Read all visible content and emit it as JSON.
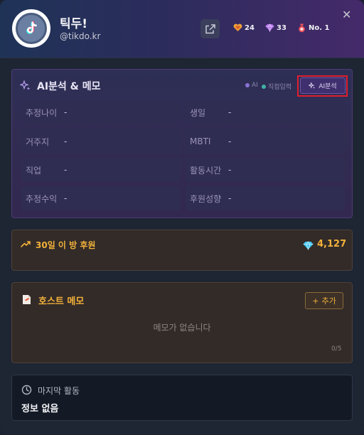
{
  "header": {
    "name": "틱두!",
    "handle": "@tikdo.kr",
    "stats": [
      {
        "icon": "heart-badge-icon",
        "value": "24",
        "color": "#f1a43a"
      },
      {
        "icon": "diamond-icon",
        "value": "33",
        "color": "#b070e8"
      },
      {
        "icon": "medal-icon",
        "value": "No. 1",
        "color": "#e8505a"
      }
    ]
  },
  "ai_panel": {
    "title": "AI분석 & 메모",
    "legend": [
      {
        "label": "AI",
        "color": "#8a73d6"
      },
      {
        "label": "직접입력",
        "color": "#3fb3a4"
      }
    ],
    "button_label": "AI분석",
    "fields": [
      {
        "label": "추정나이",
        "value": "-"
      },
      {
        "label": "생일",
        "value": "-"
      },
      {
        "label": "거주지",
        "value": "-"
      },
      {
        "label": "MBTI",
        "value": "-"
      },
      {
        "label": "직업",
        "value": "-"
      },
      {
        "label": "활동시간",
        "value": "-"
      },
      {
        "label": "추정수익",
        "value": "-"
      },
      {
        "label": "후원성향",
        "value": "-"
      }
    ]
  },
  "donation": {
    "title": "30일 이 방 후원",
    "value": "4,127"
  },
  "memo": {
    "title": "호스트 메모",
    "add_label": "추가",
    "empty_text": "메모가 없습니다",
    "count": "0/5"
  },
  "activity": {
    "label": "마지막 활동",
    "value": "정보 없음"
  }
}
